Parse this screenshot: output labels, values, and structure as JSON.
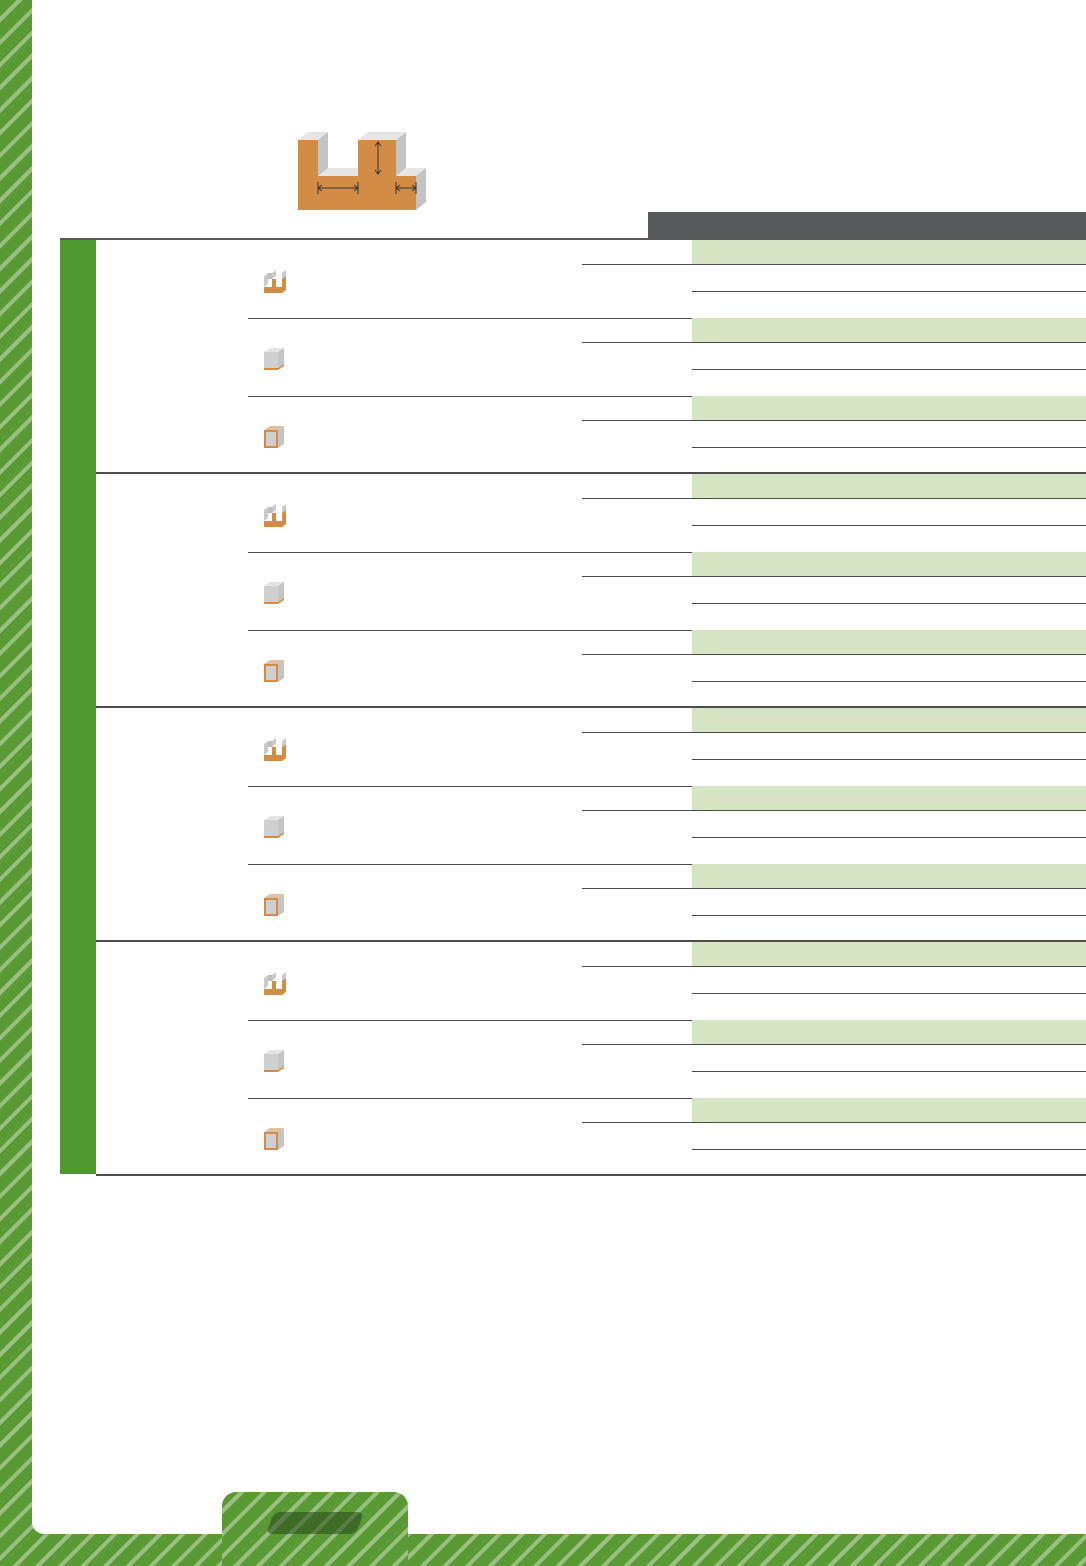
{
  "page": {
    "header_bar_label": "",
    "side_band_label": "",
    "colors": {
      "accent_green": "#5a9a34",
      "header_bar": "#58595b",
      "row_highlight": "#d7e4c4",
      "wood": "#d38c45",
      "steel": "#c9c9c9"
    }
  },
  "diagram": {
    "icon": "slot-cutter-workpiece-diagram"
  },
  "groups": [
    {
      "label": "",
      "rows": [
        {
          "icon": "double-slot-block-icon"
        },
        {
          "icon": "rebate-block-icon"
        },
        {
          "icon": "plain-block-icon"
        }
      ]
    },
    {
      "label": "",
      "rows": [
        {
          "icon": "double-slot-block-icon"
        },
        {
          "icon": "rebate-block-icon"
        },
        {
          "icon": "plain-block-icon"
        }
      ]
    },
    {
      "label": "",
      "rows": [
        {
          "icon": "double-slot-block-icon"
        },
        {
          "icon": "rebate-block-icon"
        },
        {
          "icon": "plain-block-icon"
        }
      ]
    },
    {
      "label": "",
      "rows": [
        {
          "icon": "double-slot-block-icon"
        },
        {
          "icon": "rebate-block-icon"
        },
        {
          "icon": "plain-block-icon"
        }
      ]
    }
  ]
}
